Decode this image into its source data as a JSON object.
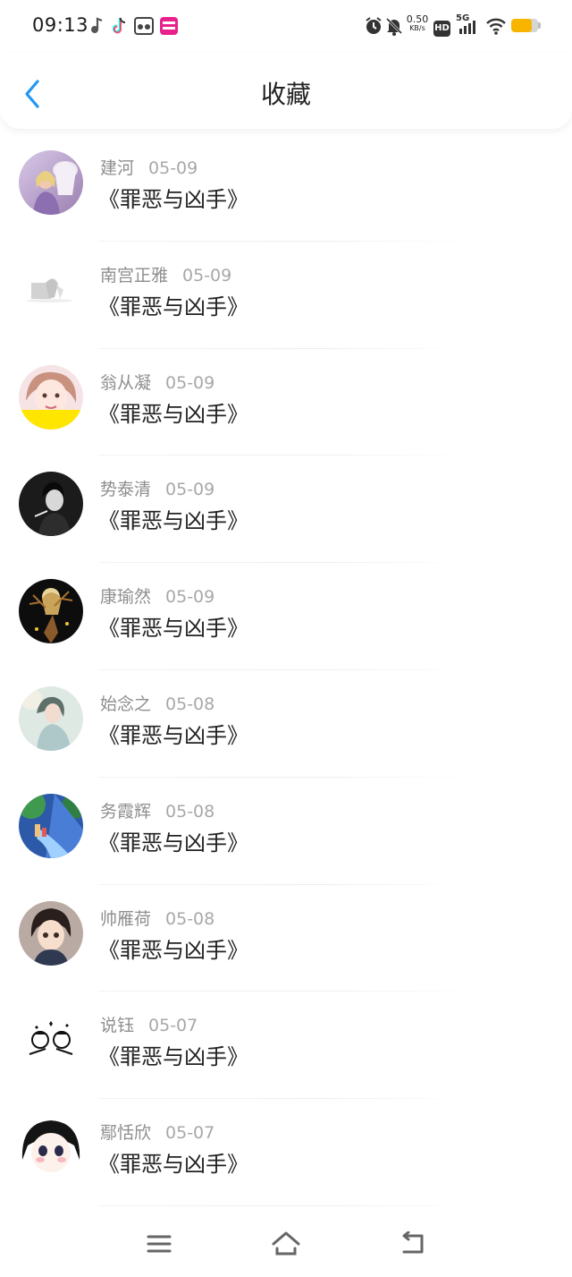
{
  "status_bar": {
    "time": "09:13",
    "net_speed": "0.50",
    "net_unit": "KB/s",
    "hd_label": "HD",
    "network_label": "5G",
    "battery_level": 0.75,
    "icons": [
      "app-notification-icon",
      "tiktok-icon",
      "app-icon",
      "app-badge-icon",
      "alarm-icon",
      "mute-icon",
      "hd-icon",
      "signal-icon",
      "wifi-icon",
      "battery-icon"
    ]
  },
  "header": {
    "title": "收藏",
    "back_icon": "chevron-left-icon"
  },
  "colors": {
    "accent": "#2196f3",
    "meta_text": "#8e8e8e",
    "title_text": "#222222",
    "battery": "#f7b500"
  },
  "items": [
    {
      "author": "建河",
      "date": "05-09",
      "title": "《罪恶与凶手》"
    },
    {
      "author": "南宫正雅",
      "date": "05-09",
      "title": "《罪恶与凶手》"
    },
    {
      "author": "翁从凝",
      "date": "05-09",
      "title": "《罪恶与凶手》"
    },
    {
      "author": "势泰清",
      "date": "05-09",
      "title": "《罪恶与凶手》"
    },
    {
      "author": "康瑜然",
      "date": "05-09",
      "title": "《罪恶与凶手》"
    },
    {
      "author": "始念之",
      "date": "05-08",
      "title": "《罪恶与凶手》"
    },
    {
      "author": "务霞辉",
      "date": "05-08",
      "title": "《罪恶与凶手》"
    },
    {
      "author": "帅雁荷",
      "date": "05-08",
      "title": "《罪恶与凶手》"
    },
    {
      "author": "说钰",
      "date": "05-07",
      "title": "《罪恶与凶手》"
    },
    {
      "author": "鄢恬欣",
      "date": "05-07",
      "title": "《罪恶与凶手》"
    }
  ],
  "nav": {
    "icons": [
      "menu-icon",
      "home-icon",
      "back-icon"
    ]
  }
}
